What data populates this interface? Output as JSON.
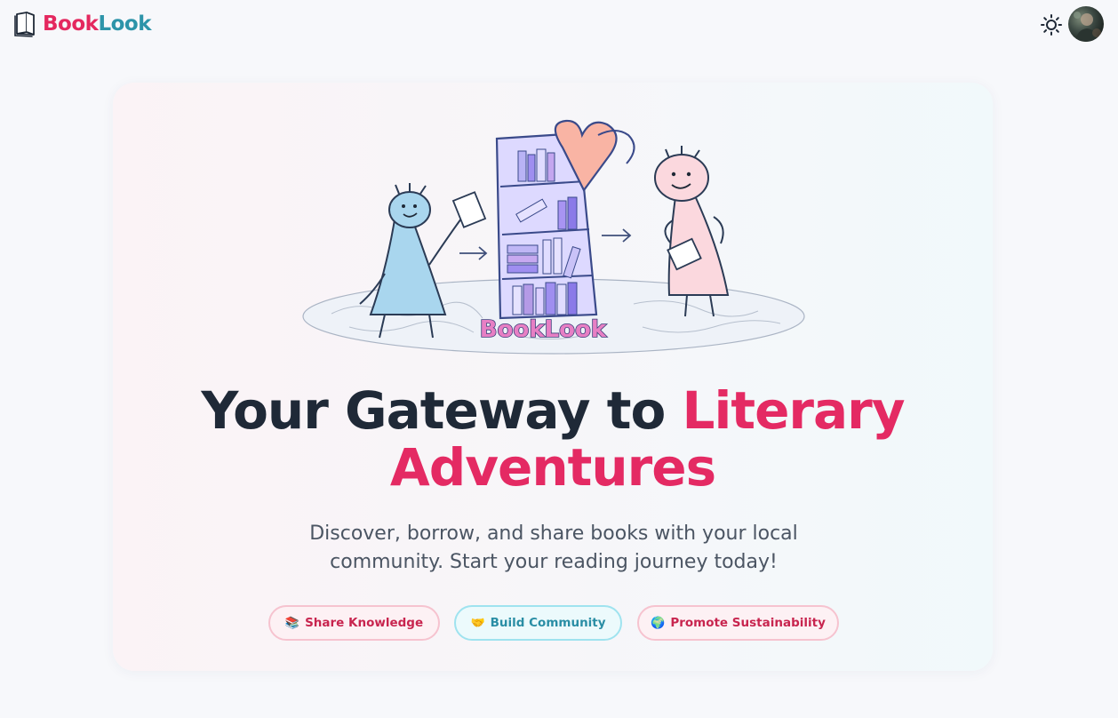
{
  "header": {
    "brand_part1": "Book",
    "brand_part2": "Look",
    "logo_icon": "open-book-icon",
    "theme_toggle_icon": "sun-icon",
    "avatar_icon": "user-avatar"
  },
  "hero": {
    "illustration_label": "BookLook",
    "headline_part1": "Your Gateway to ",
    "headline_part2": "Literary Adventures",
    "subtitle": "Discover, borrow, and share books with your local community. Start your reading journey today!",
    "pills": [
      {
        "icon": "📚",
        "label": "Share Knowledge"
      },
      {
        "icon": "🤝",
        "label": "Build Community"
      },
      {
        "icon": "🌍",
        "label": "Promote Sustainability"
      }
    ]
  },
  "colors": {
    "brand_pink": "#e4285f",
    "brand_teal": "#2d94a9",
    "headline_dark": "#1f2937",
    "pink_pill_border": "#f6c3cf",
    "teal_pill_border": "#9fe3ef"
  }
}
